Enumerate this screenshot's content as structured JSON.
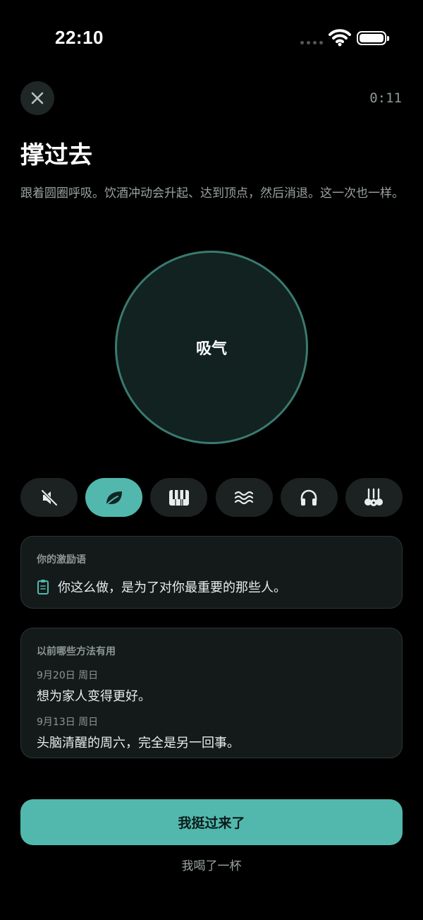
{
  "status": {
    "time": "22:10"
  },
  "header": {
    "timer": "0:11"
  },
  "title": "撑过去",
  "description": "跟着圆圈呼吸。饮酒冲动会升起、达到顶点，然后消退。这一次也一样。",
  "breath": {
    "label": "吸气"
  },
  "sounds": [
    {
      "icon": "mute-speaker-icon",
      "active": false
    },
    {
      "icon": "leaf-icon",
      "active": true
    },
    {
      "icon": "piano-icon",
      "active": false
    },
    {
      "icon": "waves-icon",
      "active": false
    },
    {
      "icon": "headphones-icon",
      "active": false
    },
    {
      "icon": "guitar-icon",
      "active": false
    }
  ],
  "motivation": {
    "title": "你的激励语",
    "text": "你这么做，是为了对你最重要的那些人。"
  },
  "history": {
    "title": "以前哪些方法有用",
    "entries": [
      {
        "date": "9月20日 周日",
        "text": "想为家人变得更好。"
      },
      {
        "date": "9月13日 周日",
        "text": "头脑清醒的周六，完全是另一回事。"
      }
    ]
  },
  "actions": {
    "primary": "我挺过来了",
    "secondary": "我喝了一杯"
  },
  "colors": {
    "accent": "#52b8ad",
    "background": "#000000",
    "card": "#141a1a"
  }
}
